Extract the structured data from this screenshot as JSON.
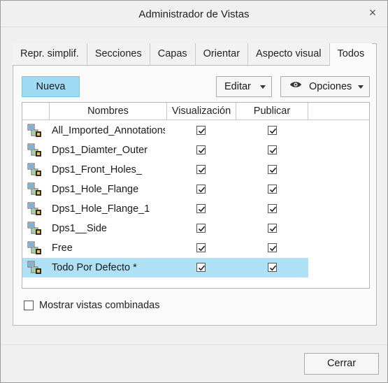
{
  "window": {
    "title": "Administrador de Vistas",
    "close_symbol": "×"
  },
  "tabs": [
    {
      "label": "Repr. simplif.",
      "active": false
    },
    {
      "label": "Secciones",
      "active": false
    },
    {
      "label": "Capas",
      "active": false
    },
    {
      "label": "Orientar",
      "active": false
    },
    {
      "label": "Aspecto visual",
      "active": false
    },
    {
      "label": "Todos",
      "active": true
    }
  ],
  "toolbar": {
    "new_label": "Nueva",
    "edit_label": "Editar",
    "options_label": "Opciones",
    "options_icon": "eye-icon"
  },
  "table": {
    "columns": [
      "Nombres",
      "Visualización",
      "Publicar"
    ],
    "rows": [
      {
        "name": "All_Imported_Annotations",
        "visible": true,
        "publish": true,
        "selected": false
      },
      {
        "name": "Dps1_Diamter_Outer",
        "visible": true,
        "publish": true,
        "selected": false
      },
      {
        "name": "Dps1_Front_Holes_",
        "visible": true,
        "publish": true,
        "selected": false
      },
      {
        "name": "Dps1_Hole_Flange",
        "visible": true,
        "publish": true,
        "selected": false
      },
      {
        "name": "Dps1_Hole_Flange_1",
        "visible": true,
        "publish": true,
        "selected": false
      },
      {
        "name": "Dps1__Side",
        "visible": true,
        "publish": true,
        "selected": false
      },
      {
        "name": "Free",
        "visible": true,
        "publish": true,
        "selected": false
      },
      {
        "name": "Todo Por Defecto *",
        "visible": true,
        "publish": true,
        "selected": true
      }
    ]
  },
  "combined_views": {
    "label": "Mostrar vistas combinadas",
    "checked": false
  },
  "footer": {
    "close_label": "Cerrar"
  },
  "colors": {
    "accent": "#9fdcf4",
    "selection": "#aee0f6"
  }
}
